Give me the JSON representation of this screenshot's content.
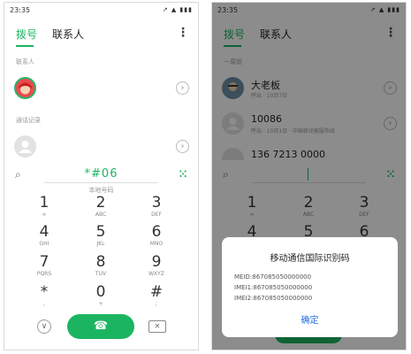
{
  "colors": {
    "accent": "#1bb561",
    "dialog_button": "#1e6fe0"
  },
  "left": {
    "time": "23:35",
    "status_icons": "↗ ▲ ▮▮▮",
    "tabs": [
      {
        "label": "拨号",
        "active": true
      },
      {
        "label": "联系人",
        "active": false
      }
    ],
    "more_icon": "⋮",
    "contacts_header": "联系人",
    "recent_header": "通话记录",
    "chevron": "›",
    "dial_input": "*#06",
    "dial_hint": "本地号码",
    "search_icon": "⌕",
    "keypad_icon": "⁙",
    "keys": [
      {
        "num": "1",
        "letters": "∞"
      },
      {
        "num": "2",
        "letters": "ABC"
      },
      {
        "num": "3",
        "letters": "DEF"
      },
      {
        "num": "4",
        "letters": "GHI"
      },
      {
        "num": "5",
        "letters": "JKL"
      },
      {
        "num": "6",
        "letters": "MNO"
      },
      {
        "num": "7",
        "letters": "PQRS"
      },
      {
        "num": "8",
        "letters": "TUV"
      },
      {
        "num": "9",
        "letters": "WXYZ"
      },
      {
        "num": "*",
        "letters": ","
      },
      {
        "num": "0",
        "letters": "+"
      },
      {
        "num": "#",
        "letters": ";"
      }
    ],
    "collapse_icon": "∨",
    "call_icon": "☎",
    "delete_icon": "✕"
  },
  "right": {
    "time": "23:35",
    "status_icons": "↗ ▲ ▮▮▮",
    "tabs": [
      {
        "label": "拨号",
        "active": true
      },
      {
        "label": "联系人",
        "active": false
      }
    ],
    "more_icon": "⋮",
    "recent_header": "一周前",
    "entries": [
      {
        "name": "大老板",
        "detail": "呼出 · 10月7日"
      },
      {
        "name": "10086",
        "detail": "呼出 · 10月1日 · 中国移动客服热线"
      },
      {
        "name": "136 7213 0000",
        "detail": ""
      }
    ],
    "chevron": "›",
    "search_icon": "⌕",
    "keypad_icon": "⁙",
    "partial_keys": [
      {
        "num": "1",
        "letters": "∞"
      },
      {
        "num": "2",
        "letters": "ABC"
      },
      {
        "num": "3",
        "letters": "DEF"
      },
      {
        "num": "4",
        "letters": ""
      },
      {
        "num": "5",
        "letters": ""
      },
      {
        "num": "6",
        "letters": ""
      }
    ],
    "dialog": {
      "title": "移动通信国际识别码",
      "lines": [
        "MEID:867085050000000",
        "IMEI1:867085050000000",
        "IMEI2:867085050000000"
      ],
      "ok": "确定"
    }
  }
}
